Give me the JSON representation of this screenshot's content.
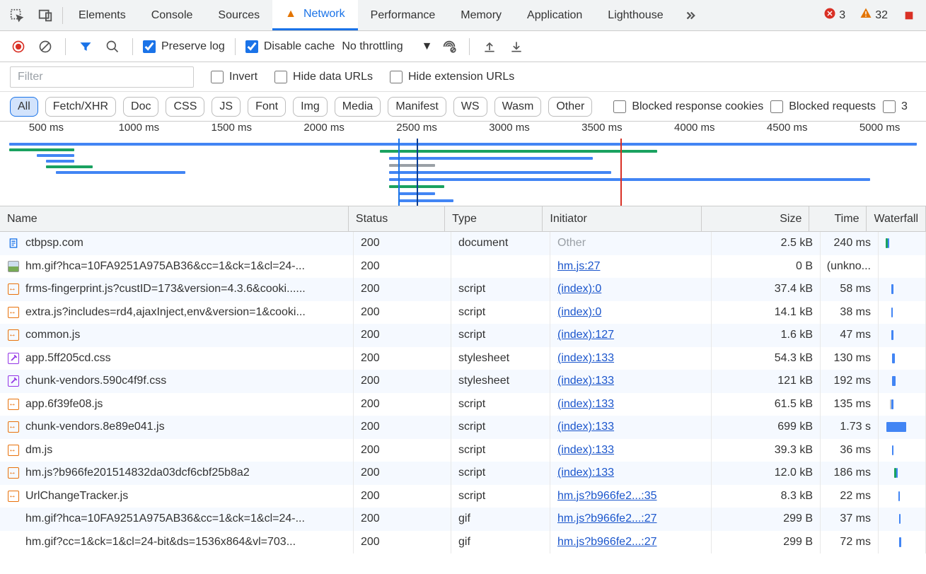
{
  "tabs": [
    "Elements",
    "Console",
    "Sources",
    "Network",
    "Performance",
    "Memory",
    "Application",
    "Lighthouse"
  ],
  "active_tab": 3,
  "badges": {
    "errors": 3,
    "warnings": 32
  },
  "toolbar": {
    "preserve_log": "Preserve log",
    "disable_cache": "Disable cache",
    "throttling": "No throttling"
  },
  "filter": {
    "placeholder": "Filter",
    "invert": "Invert",
    "hide_data_urls": "Hide data URLs",
    "hide_ext_urls": "Hide extension URLs"
  },
  "chips": [
    "All",
    "Fetch/XHR",
    "Doc",
    "CSS",
    "JS",
    "Font",
    "Img",
    "Media",
    "Manifest",
    "WS",
    "Wasm",
    "Other"
  ],
  "chip_opts": {
    "blocked_cookies": "Blocked response cookies",
    "blocked_reqs": "Blocked requests",
    "third_party_char": "3"
  },
  "ticks": [
    "500 ms",
    "1000 ms",
    "1500 ms",
    "2000 ms",
    "2500 ms",
    "3000 ms",
    "3500 ms",
    "4000 ms",
    "4500 ms",
    "5000 ms"
  ],
  "columns": {
    "name": "Name",
    "status": "Status",
    "type": "Type",
    "initiator": "Initiator",
    "size": "Size",
    "time": "Time",
    "waterfall": "Waterfall"
  },
  "rows": [
    {
      "icon": "doc",
      "name": "ctbpsp.com",
      "status": "200",
      "type": "document",
      "initiator": "Other",
      "initiator_link": false,
      "size": "2.5 kB",
      "time": "240 ms",
      "wf": [
        {
          "l": 0,
          "w": 6,
          "c": "#1aa260"
        },
        {
          "l": 6,
          "w": 4,
          "c": "#4285f4"
        }
      ]
    },
    {
      "icon": "img",
      "name": "hm.gif?hca=10FA9251A975AB36&cc=1&ck=1&cl=24-...",
      "status": "200",
      "type": "",
      "initiator": "hm.js:27",
      "initiator_link": true,
      "size": "0 B",
      "time": "(unkno...",
      "wf": []
    },
    {
      "icon": "script",
      "name": "frms-fingerprint.js?custID=173&version=4.3.6&cooki......",
      "status": "200",
      "type": "script",
      "initiator": "(index):0",
      "initiator_link": true,
      "size": "37.4 kB",
      "time": "58 ms",
      "wf": [
        {
          "l": 18,
          "w": 6,
          "c": "#4285f4"
        }
      ]
    },
    {
      "icon": "script",
      "name": "extra.js?includes=rd4,ajaxInject,env&version=1&cooki...",
      "status": "200",
      "type": "script",
      "initiator": "(index):0",
      "initiator_link": true,
      "size": "14.1 kB",
      "time": "38 ms",
      "wf": [
        {
          "l": 18,
          "w": 4,
          "c": "#4285f4"
        }
      ]
    },
    {
      "icon": "script",
      "name": "common.js",
      "status": "200",
      "type": "script",
      "initiator": "(index):127",
      "initiator_link": true,
      "size": "1.6 kB",
      "time": "47 ms",
      "wf": [
        {
          "l": 18,
          "w": 6,
          "c": "#4285f4"
        }
      ]
    },
    {
      "icon": "css",
      "name": "app.5ff205cd.css",
      "status": "200",
      "type": "stylesheet",
      "initiator": "(index):133",
      "initiator_link": true,
      "size": "54.3 kB",
      "time": "130 ms",
      "wf": [
        {
          "l": 20,
          "w": 8,
          "c": "#4285f4"
        }
      ]
    },
    {
      "icon": "css",
      "name": "chunk-vendors.590c4f9f.css",
      "status": "200",
      "type": "stylesheet",
      "initiator": "(index):133",
      "initiator_link": true,
      "size": "121 kB",
      "time": "192 ms",
      "wf": [
        {
          "l": 20,
          "w": 10,
          "c": "#4285f4"
        }
      ]
    },
    {
      "icon": "script",
      "name": "app.6f39fe08.js",
      "status": "200",
      "type": "script",
      "initiator": "(index):133",
      "initiator_link": true,
      "size": "61.5 kB",
      "time": "135 ms",
      "wf": [
        {
          "l": 14,
          "w": 4,
          "c": "#ccc"
        },
        {
          "l": 18,
          "w": 6,
          "c": "#4285f4"
        }
      ]
    },
    {
      "icon": "script",
      "name": "chunk-vendors.8e89e041.js",
      "status": "200",
      "type": "script",
      "initiator": "(index):133",
      "initiator_link": true,
      "size": "699 kB",
      "time": "1.73 s",
      "wf": [
        {
          "l": 2,
          "w": 60,
          "c": "#4285f4"
        }
      ]
    },
    {
      "icon": "script",
      "name": "dm.js",
      "status": "200",
      "type": "script",
      "initiator": "(index):133",
      "initiator_link": true,
      "size": "39.3 kB",
      "time": "36 ms",
      "wf": [
        {
          "l": 20,
          "w": 4,
          "c": "#4285f4"
        }
      ]
    },
    {
      "icon": "script",
      "name": "hm.js?b966fe201514832da03dcf6cbf25b8a2",
      "status": "200",
      "type": "script",
      "initiator": "(index):133",
      "initiator_link": true,
      "size": "12.0 kB",
      "time": "186 ms",
      "wf": [
        {
          "l": 26,
          "w": 6,
          "c": "#1aa260"
        },
        {
          "l": 32,
          "w": 4,
          "c": "#4285f4"
        }
      ]
    },
    {
      "icon": "script",
      "name": "UrlChangeTracker.js",
      "status": "200",
      "type": "script",
      "initiator": "hm.js?b966fe2...:35",
      "initiator_link": true,
      "size": "8.3 kB",
      "time": "22 ms",
      "wf": [
        {
          "l": 40,
          "w": 4,
          "c": "#4285f4"
        }
      ]
    },
    {
      "icon": "none",
      "name": "hm.gif?hca=10FA9251A975AB36&cc=1&ck=1&cl=24-...",
      "status": "200",
      "type": "gif",
      "initiator": "hm.js?b966fe2...:27",
      "initiator_link": true,
      "size": "299 B",
      "time": "37 ms",
      "wf": [
        {
          "l": 42,
          "w": 4,
          "c": "#4285f4"
        }
      ]
    },
    {
      "icon": "none",
      "name": "hm.gif?cc=1&ck=1&cl=24-bit&ds=1536x864&vl=703...",
      "status": "200",
      "type": "gif",
      "initiator": "hm.js?b966fe2...:27",
      "initiator_link": true,
      "size": "299 B",
      "time": "72 ms",
      "wf": [
        {
          "l": 42,
          "w": 6,
          "c": "#4285f4"
        }
      ]
    }
  ]
}
